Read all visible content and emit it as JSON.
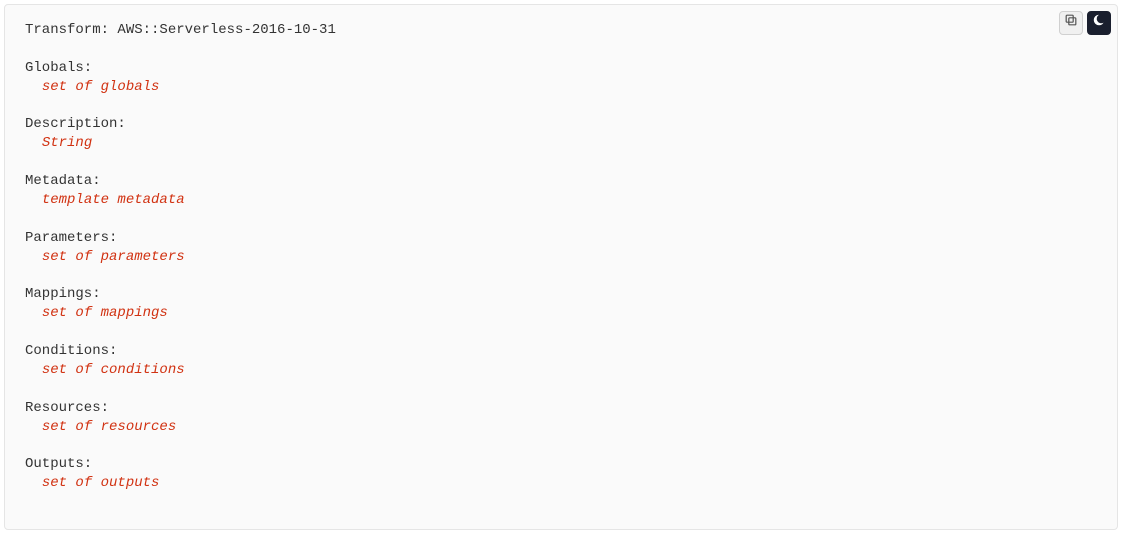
{
  "code": {
    "transform_key": "Transform:",
    "transform_value": " AWS::Serverless-2016-10-31",
    "sections": [
      {
        "key": "Globals:",
        "value": "set of globals"
      },
      {
        "key": "Description:",
        "value": "String"
      },
      {
        "key": "Metadata:",
        "value": "template metadata"
      },
      {
        "key": "Parameters:",
        "value": "set of parameters"
      },
      {
        "key": "Mappings:",
        "value": "set of mappings"
      },
      {
        "key": "Conditions:",
        "value": "set of conditions"
      },
      {
        "key": "Resources:",
        "value": "set of resources"
      },
      {
        "key": "Outputs:",
        "value": "set of outputs"
      }
    ]
  }
}
